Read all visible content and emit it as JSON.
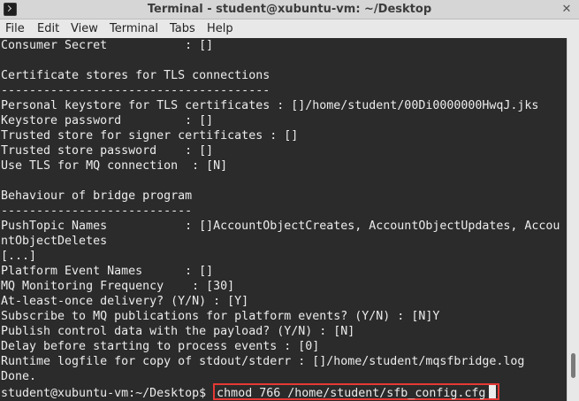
{
  "window": {
    "title": "Terminal - student@xubuntu-vm: ~/Desktop",
    "close_label": "✕"
  },
  "menu": {
    "items": [
      "File",
      "Edit",
      "View",
      "Terminal",
      "Tabs",
      "Help"
    ]
  },
  "terminal": {
    "lines": [
      "Consumer Secret           : []",
      "",
      "Certificate stores for TLS connections",
      "--------------------------------------",
      "Personal keystore for TLS certificates : []/home/student/00Di0000000HwqJ.jks",
      "Keystore password         : []",
      "Trusted store for signer certificates : []",
      "Trusted store password    : []",
      "Use TLS for MQ connection  : [N]",
      "",
      "Behaviour of bridge program",
      "---------------------------",
      "PushTopic Names           : []AccountObjectCreates, AccountObjectUpdates, Accou",
      "ntObjectDeletes",
      "[...]",
      "Platform Event Names      : []",
      "MQ Monitoring Frequency    : [30]",
      "At-least-once delivery? (Y/N) : [Y]",
      "Subscribe to MQ publications for platform events? (Y/N) : [N]Y",
      "Publish control data with the payload? (Y/N) : [N]",
      "Delay before starting to process events : [0]",
      "Runtime logfile for copy of stdout/stderr : []/home/student/mqsfbridge.log",
      "Done."
    ],
    "prompt": "student@xubuntu-vm:~/Desktop$ ",
    "command": "chmod 766 /home/student/sfb_config.cfg"
  }
}
